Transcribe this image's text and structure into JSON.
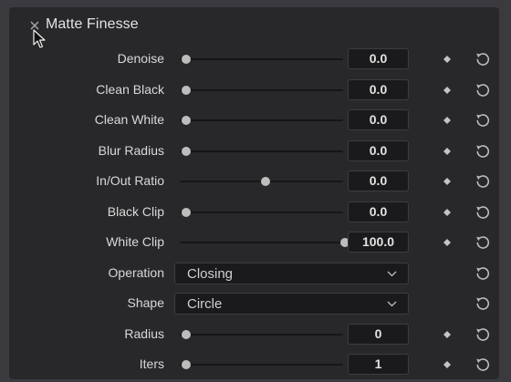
{
  "panel": {
    "title": "Matte Finesse",
    "collapse_icon": "collapse-icon",
    "cursor_icon": "mouse-cursor-icon"
  },
  "parameters": [
    {
      "label": "Denoise",
      "type": "slider",
      "value": "0.0",
      "level": 0
    },
    {
      "label": "Clean Black",
      "type": "slider",
      "value": "0.0",
      "level": 0
    },
    {
      "label": "Clean White",
      "type": "slider",
      "value": "0.0",
      "level": 0
    },
    {
      "label": "Blur Radius",
      "type": "slider",
      "value": "0.0",
      "level": 0
    },
    {
      "label": "In/Out Ratio",
      "type": "slider",
      "value": "0.0",
      "level": 0.5
    },
    {
      "label": "Black Clip",
      "type": "slider",
      "value": "0.0",
      "level": 0
    },
    {
      "label": "White Clip",
      "type": "slider",
      "value": "100.0",
      "level": 1
    },
    {
      "label": "Operation",
      "type": "dropdown",
      "value": "Closing"
    },
    {
      "label": "Shape",
      "type": "dropdown",
      "value": "Circle"
    },
    {
      "label": "Radius",
      "type": "slider",
      "value": "0",
      "level": 0
    },
    {
      "label": "Iters",
      "type": "slider",
      "value": "1",
      "level": 0
    }
  ],
  "icons": {
    "keyframe": "keyframe-diamond-icon",
    "reset": "reset-icon",
    "dropdown": "chevron-down-icon"
  },
  "colors": {
    "panel_bg": "#28282b",
    "outer_bg": "#3b3a3e",
    "field_bg": "#1a1a1c",
    "thumb": "#bdbdbd"
  }
}
